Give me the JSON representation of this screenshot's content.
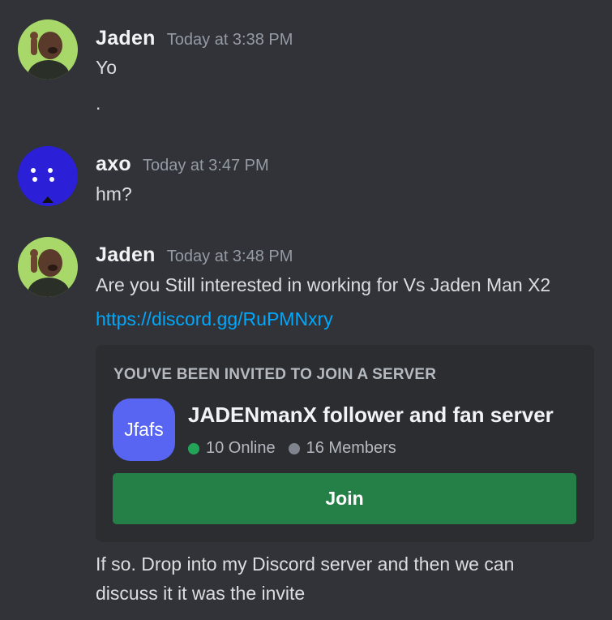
{
  "messages": [
    {
      "author": "Jaden",
      "timestamp": "Today at 3:38 PM",
      "lines": [
        "Yo",
        "."
      ]
    },
    {
      "author": "axo",
      "timestamp": "Today at 3:47 PM",
      "lines": [
        "hm?"
      ]
    },
    {
      "author": "Jaden",
      "timestamp": "Today at 3:48 PM",
      "lines": [
        "Are you Still interested in working for Vs Jaden Man X2"
      ],
      "link": "https://discord.gg/RuPMNxry",
      "followup": [
        "If so. Drop into my Discord server and then we can",
        "discuss it it was the invite"
      ]
    }
  ],
  "invite": {
    "heading": "YOU'VE BEEN INVITED TO JOIN A SERVER",
    "server_icon_text": "Jfafs",
    "server_name": "JADENmanX follower and fan server",
    "online": "10 Online",
    "members": "16 Members",
    "join_label": "Join"
  },
  "colors": {
    "background": "#313338",
    "link": "#00a8fc",
    "join_button": "#248046",
    "server_icon": "#5865f2",
    "online_dot": "#23a559",
    "axo_avatar": "#2b1fd8",
    "jaden_avatar": "#a9d86a"
  },
  "icons": {
    "jaden_avatar": "jaden-avatar",
    "axo_avatar": "axo-avatar"
  }
}
